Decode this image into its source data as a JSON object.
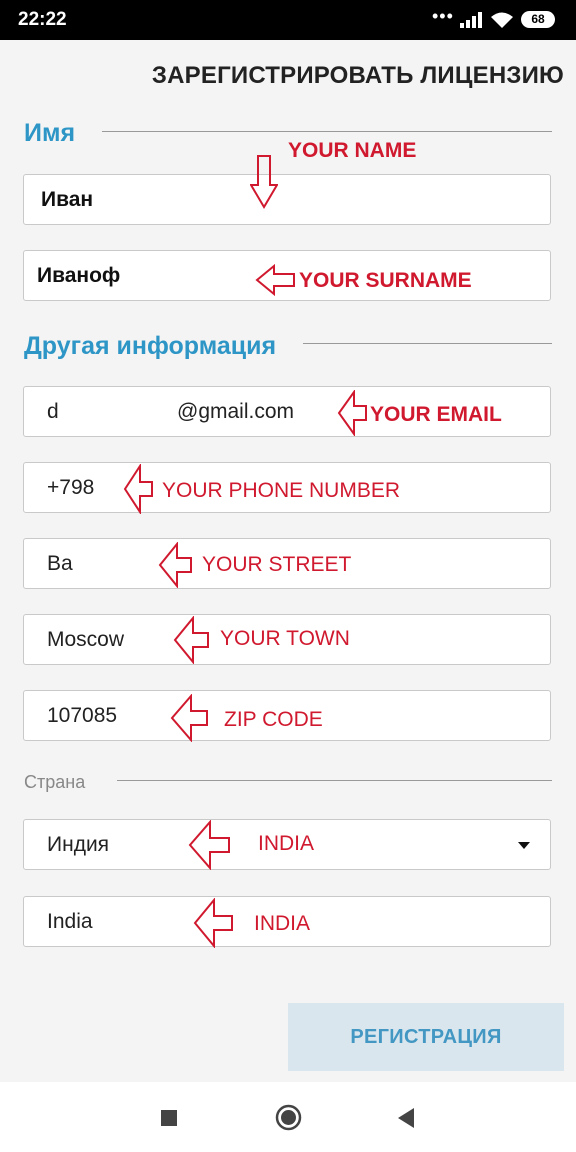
{
  "status_bar": {
    "time": "22:22",
    "dots": "•••",
    "battery": "68"
  },
  "header": {
    "title": "ЗАРЕГИСТРИРОВАТЬ ЛИЦЕНЗИЮ"
  },
  "sections": {
    "name": "Имя",
    "other": "Другая информация",
    "country_label": "Страна"
  },
  "fields": {
    "first_name": "Иван",
    "surname": "Иванoф",
    "email_prefix": "d",
    "email_domain": "@gmail.com",
    "phone": "+798",
    "street": "Ba",
    "town": "Moscow",
    "zip": "107085",
    "country_select": "Индия",
    "country_text": "India"
  },
  "annotations": {
    "name": "YOUR NAME",
    "surname": "YOUR SURNAME",
    "email": "YOUR EMAIL",
    "phone": "YOUR PHONE NUMBER",
    "street": "YOUR STREET",
    "town": "YOUR TOWN",
    "zip": "ZIP CODE",
    "country_select": "INDIA",
    "country_text": "INDIA"
  },
  "buttons": {
    "register": "РЕГИСТРАЦИЯ"
  },
  "colors": {
    "accent": "#2e96c6",
    "annotation": "#d0192e",
    "button_bg": "#d9e6ee"
  },
  "icons": [
    "wifi-icon",
    "signal-icon",
    "battery-icon",
    "dropdown-caret-icon",
    "nav-back-icon",
    "nav-home-icon",
    "nav-recents-icon"
  ]
}
